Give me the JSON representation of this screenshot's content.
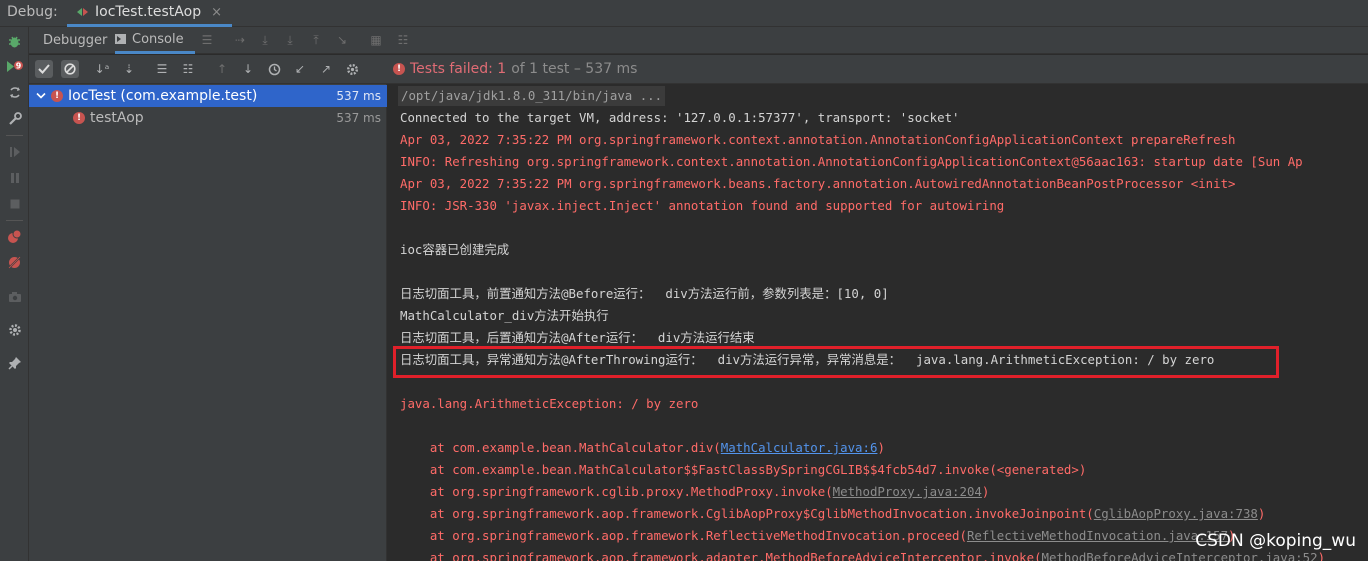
{
  "topbar": {
    "debug_label": "Debug:",
    "tab_title": "IocTest.testAop",
    "tab_close": "×"
  },
  "subbar": {
    "debugger_label": "Debugger",
    "console_label": "Console"
  },
  "tree": {
    "root": {
      "label": "IocTest (com.example.test)",
      "time": "537 ms"
    },
    "child": {
      "label": "testAop",
      "time": "537 ms"
    }
  },
  "status": {
    "failed_label": "Tests failed:",
    "failed_count": "1",
    "rest": "of 1 test – 537 ms"
  },
  "console": {
    "cmd": "/opt/java/jdk1.8.0_311/bin/java ...",
    "connected": "Connected to the target VM, address: '127.0.0.1:57377', transport: 'socket'",
    "log1": "Apr 03, 2022 7:35:22 PM org.springframework.context.annotation.AnnotationConfigApplicationContext prepareRefresh",
    "log2": "INFO: Refreshing org.springframework.context.annotation.AnnotationConfigApplicationContext@56aac163: startup date [Sun Ap",
    "log3": "Apr 03, 2022 7:35:22 PM org.springframework.beans.factory.annotation.AutowiredAnnotationBeanPostProcessor <init>",
    "log4": "INFO: JSR-330 'javax.inject.Inject' annotation found and supported for autowiring",
    "ioc_done": "ioc容器已创建完成",
    "before": "日志切面工具，前置通知方法@Before运行：  div方法运行前，参数列表是：[10, 0]",
    "div_start": "MathCalculator_div方法开始执行",
    "after": "日志切面工具，后置通知方法@After运行：  div方法运行结束",
    "after_throwing": "日志切面工具，异常通知方法@AfterThrowing运行：  div方法运行异常，异常消息是：  java.lang.ArithmeticException: / by zero",
    "exception": "java.lang.ArithmeticException: / by zero",
    "st1_pre": "    at com.example.bean.MathCalculator.div(",
    "st1_link": "MathCalculator.java:6",
    "st1_post": ")",
    "st2": "    at com.example.bean.MathCalculator$$FastClassBySpringCGLIB$$4fcb54d7.invoke(<generated>)",
    "st3_pre": "    at org.springframework.cglib.proxy.MethodProxy.invoke(",
    "st3_link": "MethodProxy.java:204",
    "st3_post": ")",
    "st4_pre": "    at org.springframework.aop.framework.CglibAopProxy$CglibMethodInvocation.invokeJoinpoint(",
    "st4_link": "CglibAopProxy.java:738",
    "st4_post": ")",
    "st5_pre": "    at org.springframework.aop.framework.ReflectiveMethodInvocation.proceed(",
    "st5_link": "ReflectiveMethodInvocation.java:157",
    "st5_post": ")",
    "st6_pre": "    at org.springframework.aop.framework.adapter.MethodBeforeAdviceInterceptor.invoke(",
    "st6_link": "MethodBeforeAdviceInterceptor.java:52",
    "st6_post": ")"
  },
  "watermark": "CSDN @koping_wu",
  "colors": {
    "selection": "#2f65ca",
    "error": "#ff6b68",
    "highlight": "#e0202a"
  },
  "icons": {
    "left": [
      "bug-icon",
      "rerun-failed-icon",
      "restore-layout-icon",
      "wrench-icon",
      "resume-icon",
      "pause-icon",
      "stop-icon",
      "view-breakpoints-icon",
      "mute-breakpoints-icon",
      "camera-icon",
      "settings-icon",
      "pin-icon"
    ]
  }
}
